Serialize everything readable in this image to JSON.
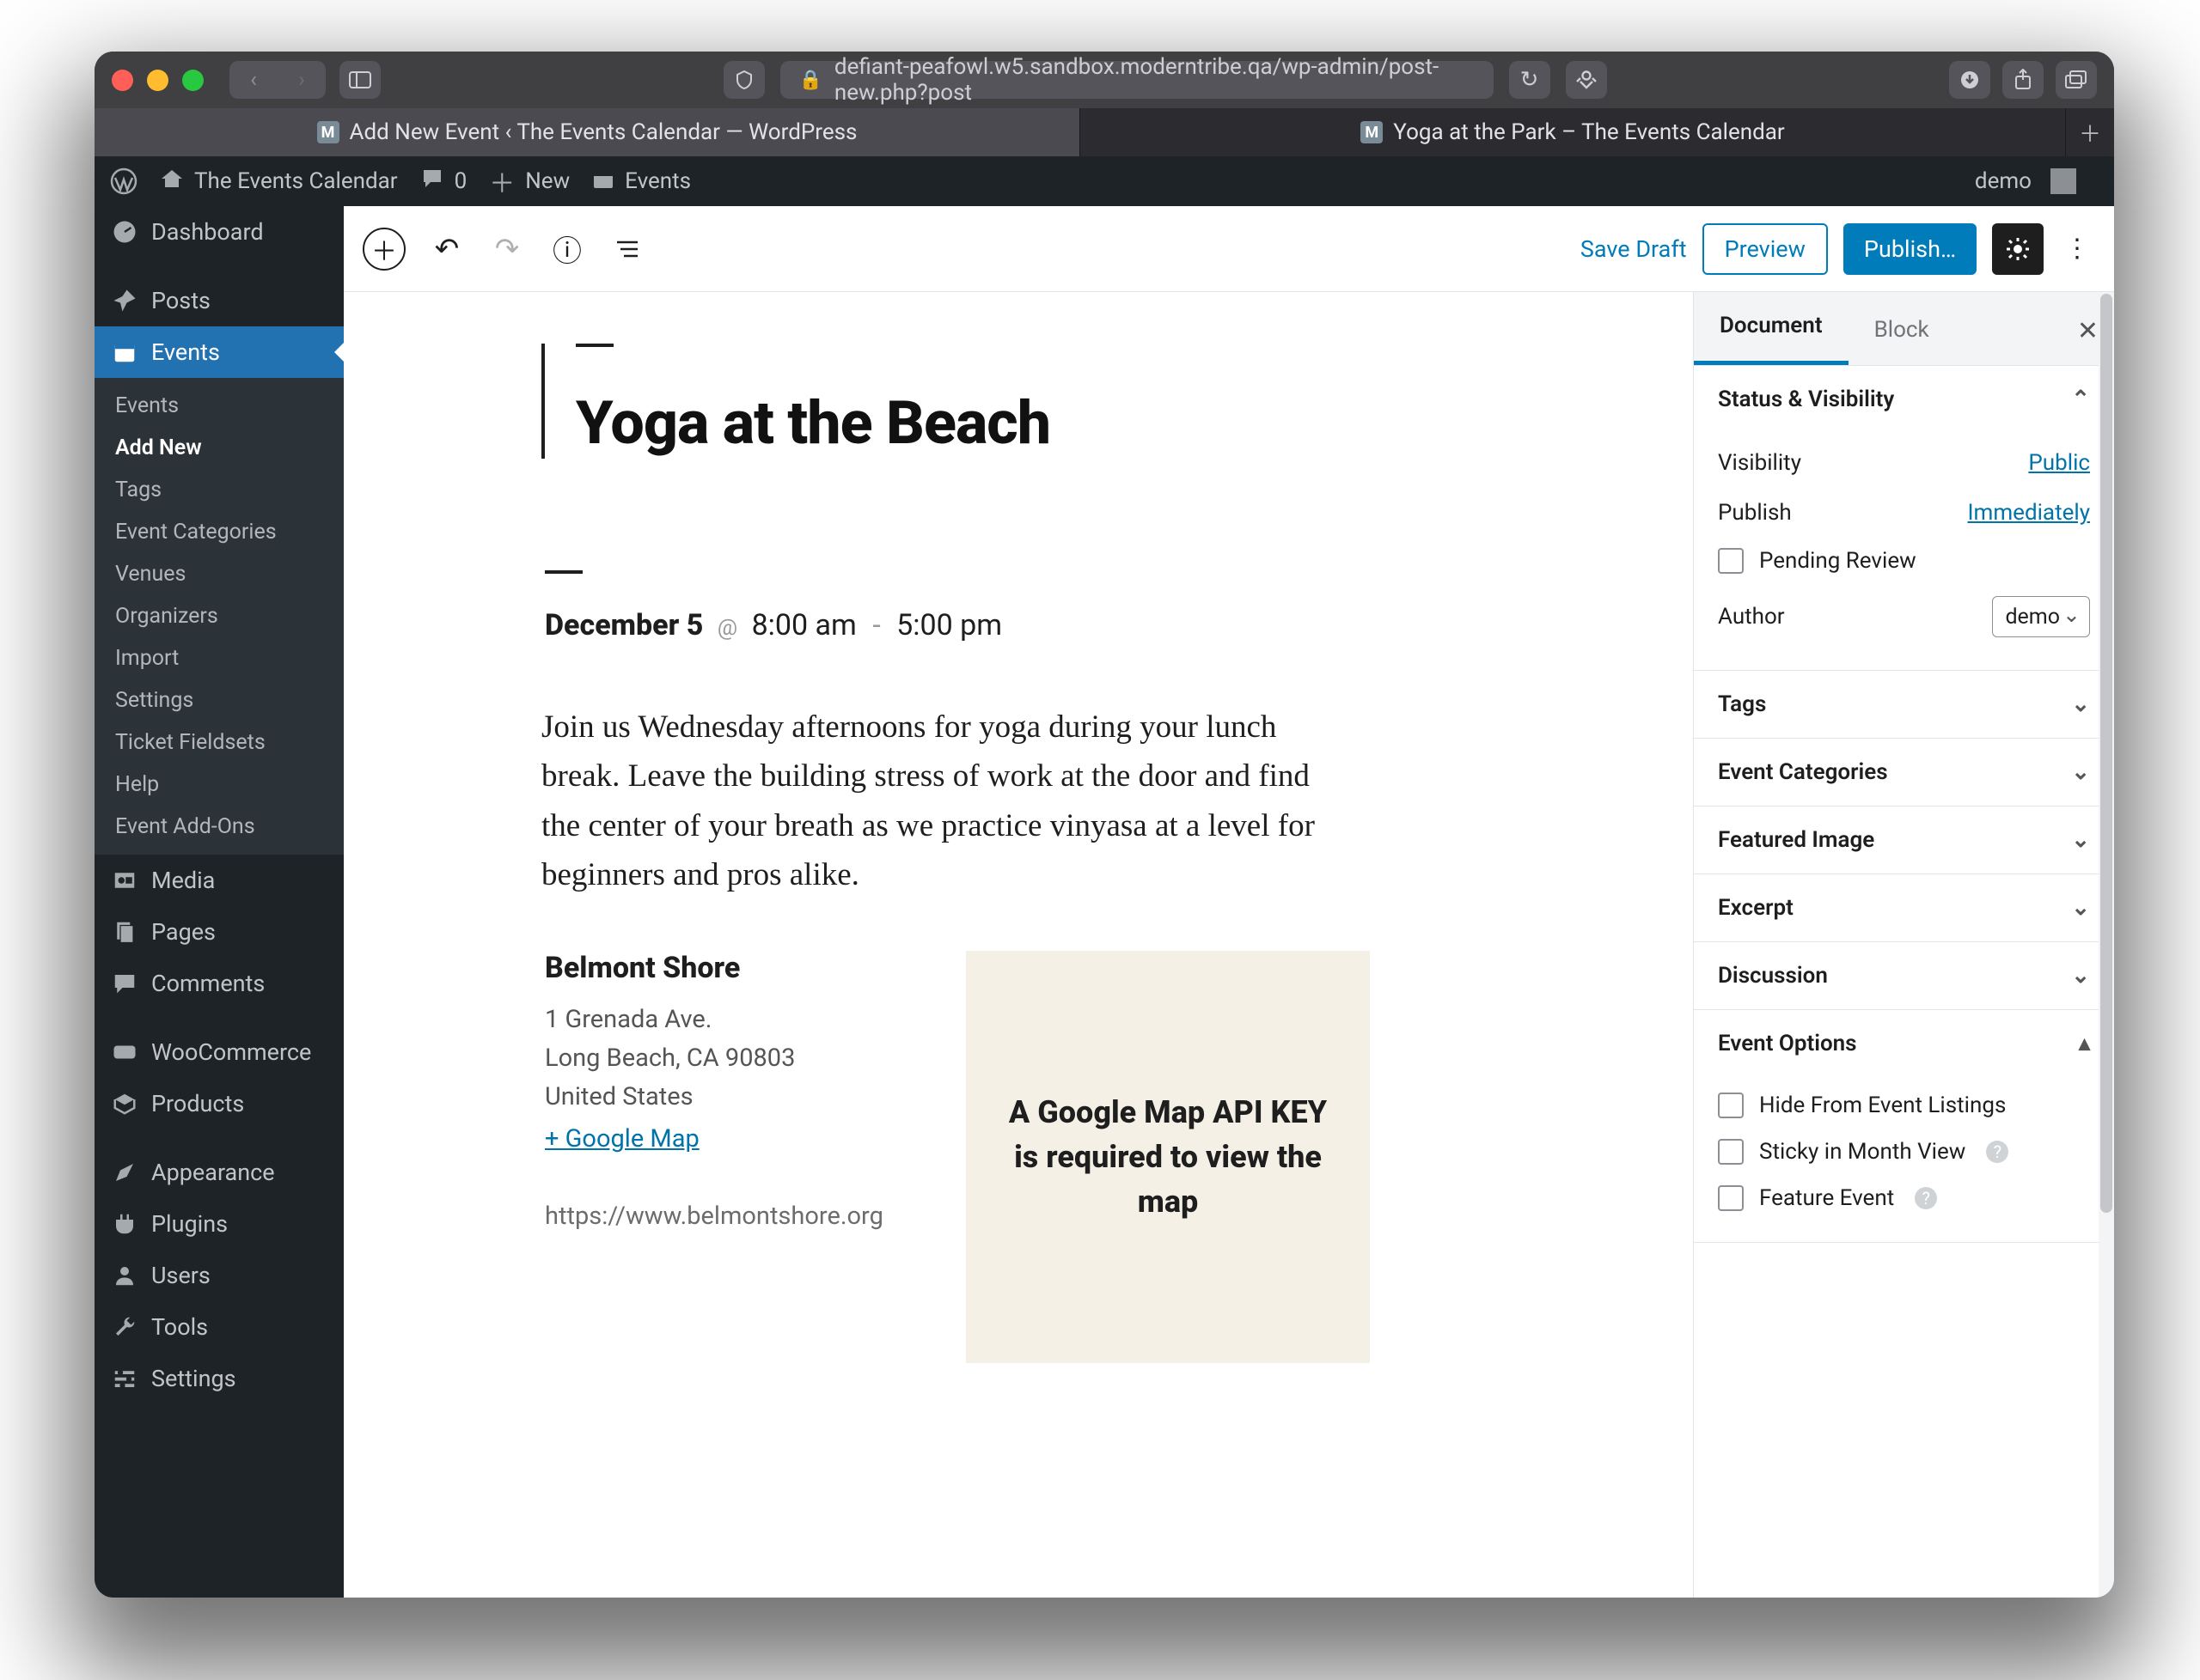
{
  "browser": {
    "url": "defiant-peafowl.w5.sandbox.moderntribe.qa/wp-admin/post-new.php?post",
    "tabs": [
      {
        "label": "Add New Event ‹ The Events Calendar — WordPress",
        "active": true
      },
      {
        "label": "Yoga at the Park – The Events Calendar",
        "active": false
      }
    ]
  },
  "adminbar": {
    "site": "The Events Calendar",
    "comments": "0",
    "new": "New",
    "events": "Events",
    "user": "demo"
  },
  "sidebar": {
    "top": [
      {
        "label": "Dashboard",
        "icon": "dashboard"
      },
      {
        "label": "Posts",
        "icon": "pin"
      },
      {
        "label": "Events",
        "icon": "calendar",
        "current": true
      }
    ],
    "events_sub": [
      {
        "label": "Events"
      },
      {
        "label": "Add New",
        "active": true
      },
      {
        "label": "Tags"
      },
      {
        "label": "Event Categories"
      },
      {
        "label": "Venues"
      },
      {
        "label": "Organizers"
      },
      {
        "label": "Import"
      },
      {
        "label": "Settings"
      },
      {
        "label": "Ticket Fieldsets"
      },
      {
        "label": "Help"
      },
      {
        "label": "Event Add-Ons"
      }
    ],
    "rest": [
      {
        "label": "Media",
        "icon": "media"
      },
      {
        "label": "Pages",
        "icon": "pages"
      },
      {
        "label": "Comments",
        "icon": "comments"
      },
      {
        "label": "WooCommerce",
        "icon": "woo"
      },
      {
        "label": "Products",
        "icon": "products"
      },
      {
        "label": "Appearance",
        "icon": "appearance"
      },
      {
        "label": "Plugins",
        "icon": "plugins"
      },
      {
        "label": "Users",
        "icon": "users"
      },
      {
        "label": "Tools",
        "icon": "tools"
      },
      {
        "label": "Settings",
        "icon": "settings"
      }
    ]
  },
  "toolbar": {
    "save_draft": "Save Draft",
    "preview": "Preview",
    "publish": "Publish…"
  },
  "post": {
    "title": "Yoga at the Beach",
    "date": "December 5",
    "at": "@",
    "start": "8:00 am",
    "dash": "-",
    "end": "5:00 pm",
    "description": "Join us Wednesday afternoons for yoga during your lunch break. Leave the building stress of work at the door and find the center of your breath as we practice vinyasa at a level for beginners and pros alike.",
    "venue": {
      "name": "Belmont Shore",
      "addr1": "1 Grenada Ave.",
      "addr2": "Long Beach, CA 90803",
      "country": "United States",
      "gmap": "+ Google Map",
      "site": "https://www.belmontshore.org"
    },
    "map_msg": "A Google Map API KEY is required to view the map"
  },
  "panel": {
    "tabs": {
      "document": "Document",
      "block": "Block"
    },
    "status": {
      "title": "Status & Visibility",
      "visibility_label": "Visibility",
      "visibility_value": "Public",
      "publish_label": "Publish",
      "publish_value": "Immediately",
      "pending": "Pending Review",
      "author_label": "Author",
      "author_value": "demo"
    },
    "sections": [
      "Tags",
      "Event Categories",
      "Featured Image",
      "Excerpt",
      "Discussion"
    ],
    "event_options": {
      "title": "Event Options",
      "opts": [
        "Hide From Event Listings",
        "Sticky in Month View",
        "Feature Event"
      ]
    }
  }
}
